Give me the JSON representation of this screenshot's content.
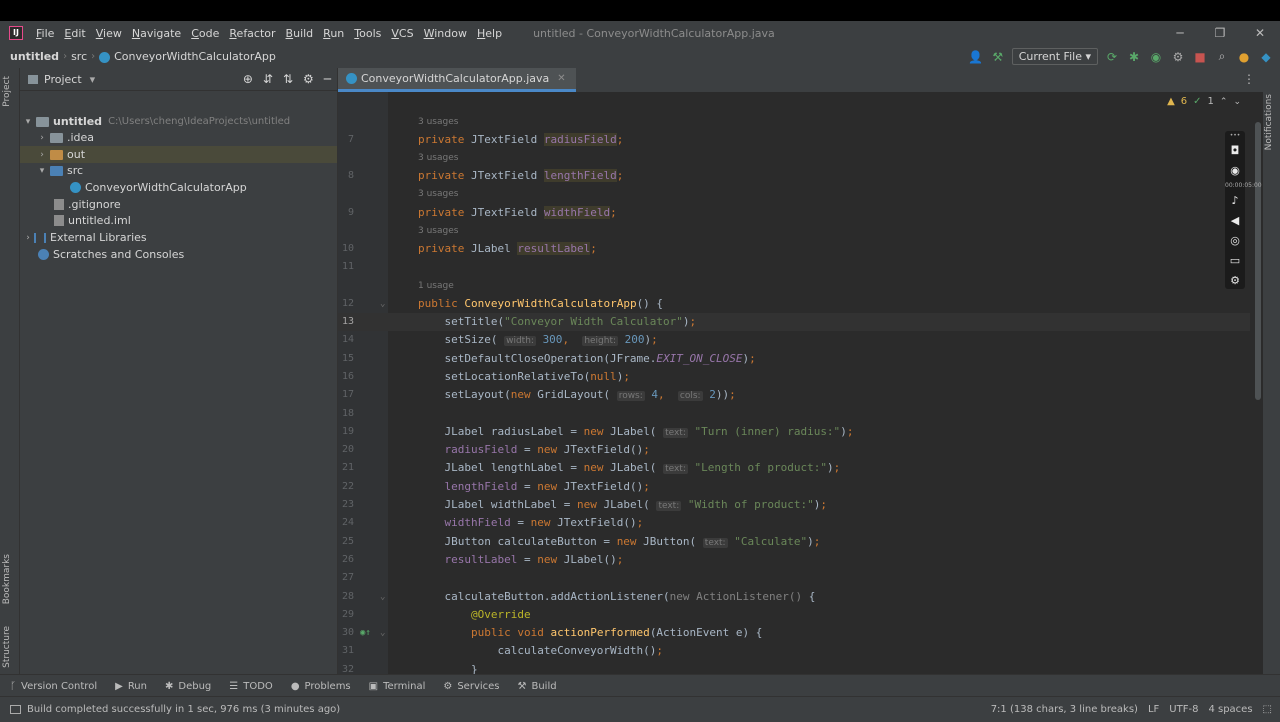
{
  "menu": [
    "File",
    "Edit",
    "View",
    "Navigate",
    "Code",
    "Refactor",
    "Build",
    "Run",
    "Tools",
    "VCS",
    "Window",
    "Help"
  ],
  "window_title": "untitled - ConveyorWidthCalculatorApp.java",
  "breadcrumb": {
    "project": "untitled",
    "folder": "src",
    "file": "ConveyorWidthCalculatorApp"
  },
  "run_config": "Current File",
  "project_pane": {
    "title": "Project",
    "tree": [
      {
        "label": "untitled",
        "path": "C:\\Users\\cheng\\IdeaProjects\\untitled",
        "expanded": true,
        "bold": true
      },
      {
        "label": ".idea"
      },
      {
        "label": "out"
      },
      {
        "label": "src"
      },
      {
        "label": "ConveyorWidthCalculatorApp"
      },
      {
        "label": ".gitignore"
      },
      {
        "label": "untitled.iml"
      },
      {
        "label": "External Libraries"
      },
      {
        "label": "Scratches and Consoles"
      }
    ]
  },
  "left_strip": {
    "top": "Project",
    "mid": "Bookmarks",
    "bottom": "Structure"
  },
  "right_strip": "Notifications",
  "editor_tab": "ConveyorWidthCalculatorApp.java",
  "inspections": {
    "warnings": "6",
    "ok": "1"
  },
  "usages": {
    "three": "3 usages",
    "one": "1 usage"
  },
  "line_numbers": [
    "7",
    "8",
    "9",
    "10",
    "11",
    "12",
    "13",
    "14",
    "15",
    "16",
    "17",
    "18",
    "19",
    "20",
    "21",
    "22",
    "23",
    "24",
    "25",
    "26",
    "27",
    "28",
    "29",
    "30",
    "31",
    "32"
  ],
  "recorder_time": "00:00:05:00",
  "tool_windows": [
    "Version Control",
    "Run",
    "Debug",
    "TODO",
    "Problems",
    "Terminal",
    "Services",
    "Build"
  ],
  "status": {
    "message": "Build completed successfully in 1 sec, 976 ms (3 minutes ago)",
    "position": "7:1 (138 chars, 3 line breaks)",
    "line_sep": "LF",
    "encoding": "UTF-8",
    "indent": "4 spaces"
  }
}
